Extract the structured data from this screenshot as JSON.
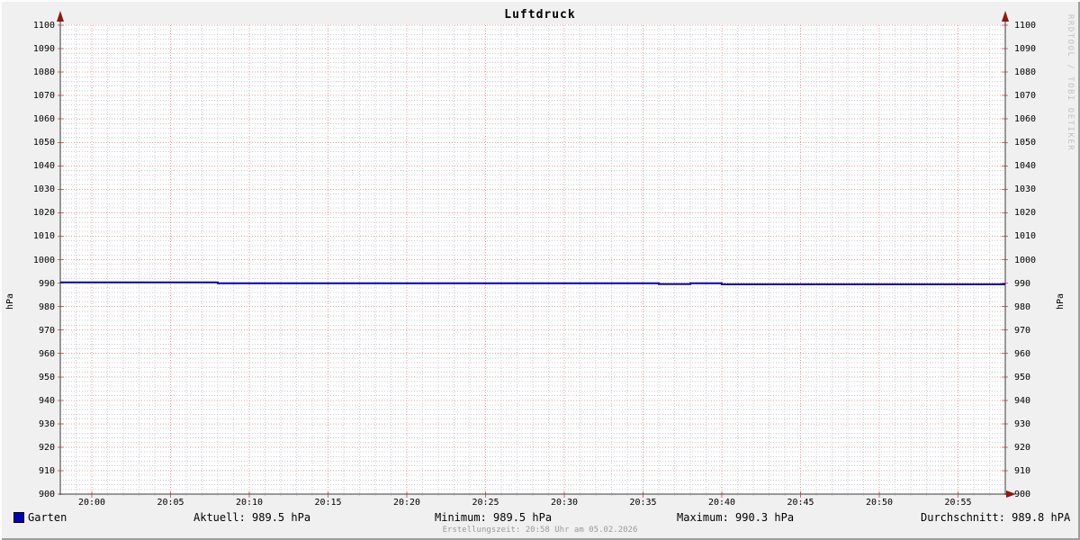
{
  "title": "Luftdruck",
  "watermark": "RRDTOOL / TOBI OETIKER",
  "footer": "Erstellungszeit: 20:58 Uhr am 05.02.2026",
  "y_axis": {
    "left_label": "hPa",
    "right_label": "hPa"
  },
  "legend": {
    "series_label": "Garten",
    "series_swatch_color": "#0000b4",
    "stats": [
      "Aktuell: 989.5 hPa",
      "Minimum: 989.5 hPa",
      "Maximum: 990.3 hPa",
      "Durchschnitt: 989.8 hPA"
    ]
  },
  "colors": {
    "background": "#f0f0f0",
    "canvas": "#ffffff",
    "major_grid": "#e89c9c",
    "minor_grid": "#cbcbd4",
    "major_tick": "#d46a6a",
    "minor_tick": "#b4b4b4",
    "axis": "#3a3a3a",
    "arrow": "#8b1a0f",
    "series_line": "#0000b4",
    "footer_text": "#9a9a9a",
    "watermark_text": "#c2c2c2"
  },
  "chart_data": {
    "type": "line",
    "title": "Luftdruck",
    "ylabel": "hPa",
    "ylim": [
      900,
      1100
    ],
    "y_tick_step": 10,
    "y_minor_step": 2,
    "x_start": "19:58",
    "x_end": "20:58",
    "x_minor_step_minutes": 1,
    "x_tick_labels": [
      "20:00",
      "20:05",
      "20:10",
      "20:15",
      "20:20",
      "20:25",
      "20:30",
      "20:35",
      "20:40",
      "20:45",
      "20:50",
      "20:55"
    ],
    "grid": true,
    "legend_position": "bottom",
    "series": [
      {
        "name": "Garten",
        "color": "#0000b4",
        "points": [
          [
            "19:58",
            990.3
          ],
          [
            "20:08",
            990.3
          ],
          [
            "20:08",
            989.9
          ],
          [
            "20:36",
            989.9
          ],
          [
            "20:36",
            989.6
          ],
          [
            "20:38",
            989.6
          ],
          [
            "20:38",
            989.9
          ],
          [
            "20:40",
            989.9
          ],
          [
            "20:40",
            989.5
          ],
          [
            "20:58",
            989.5
          ]
        ]
      }
    ],
    "stats": {
      "aktuell_hpa": 989.5,
      "minimum_hpa": 989.5,
      "maximum_hpa": 990.3,
      "durchschnitt_hpa": 989.8
    }
  }
}
